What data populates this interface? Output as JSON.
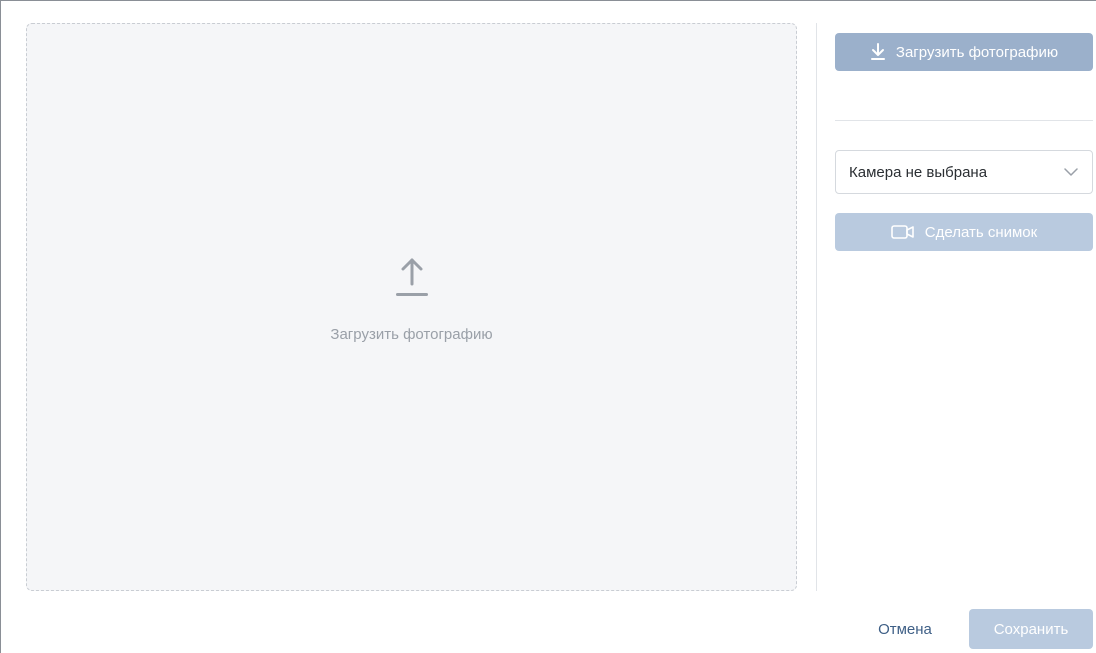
{
  "dropzone": {
    "label": "Загрузить фотографию",
    "icon": "upload-icon"
  },
  "sidebar": {
    "upload_button": {
      "label": "Загрузить фотографию",
      "icon": "download-icon"
    },
    "camera_select": {
      "value": "Камера не выбрана",
      "icon": "chevron-down-icon"
    },
    "snapshot_button": {
      "label": "Сделать снимок",
      "icon": "video-camera-icon"
    }
  },
  "footer": {
    "cancel_label": "Отмена",
    "save_label": "Сохранить"
  },
  "colors": {
    "primary_button": "#9bb0cb",
    "disabled_button": "#b9cadf",
    "link": "#3e5f86",
    "dropzone_bg": "#f5f6f8"
  }
}
